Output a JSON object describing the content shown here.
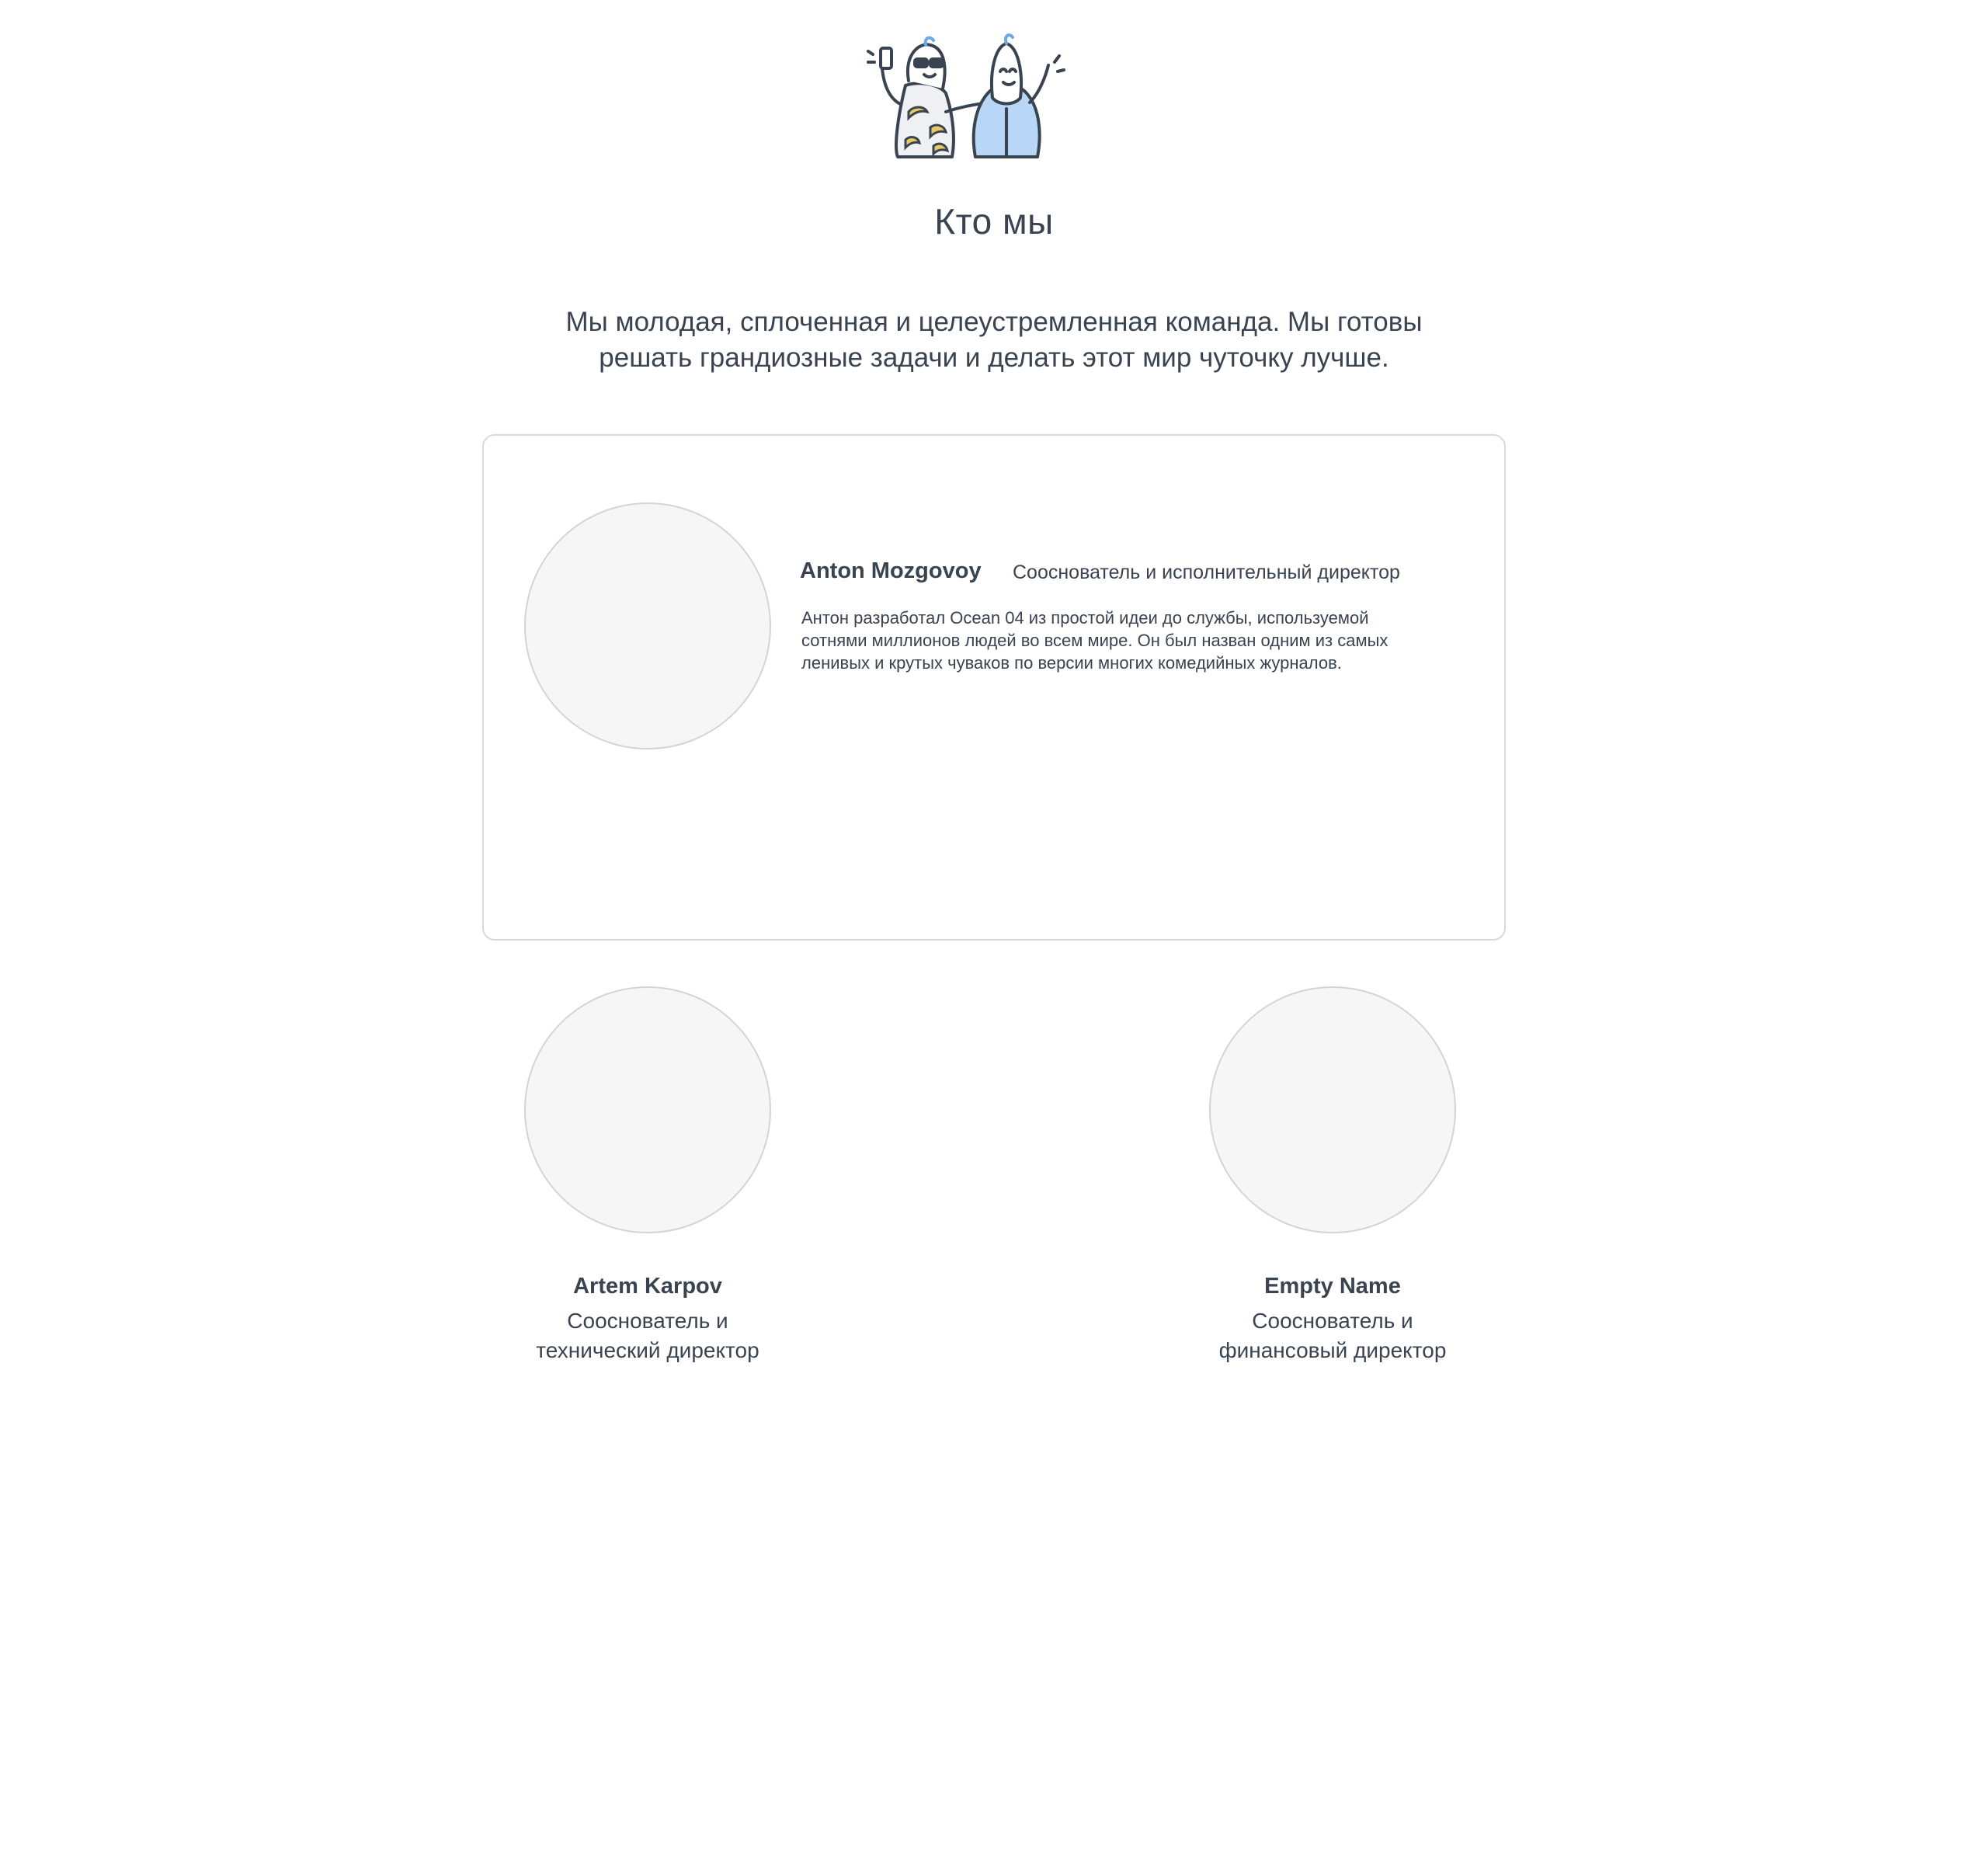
{
  "colors": {
    "text": "#3a4350",
    "card_border": "#d7d9dd",
    "avatar_fill": "#f6f6f6",
    "avatar_border": "#d4d4d4",
    "illustration_blue": "#b8d6f5",
    "illustration_accent": "#6ea8e6",
    "illustration_banana": "#e8c96a"
  },
  "hero": {
    "illustration": "team-mascots-illustration"
  },
  "about": {
    "title": "Кто мы",
    "intro": "Мы молодая, сплоченная и целеустремленная команда. Мы готовы решать грандиозные задачи и делать этот мир чуточку лучше."
  },
  "featured": {
    "name": "Anton Mozgovoy",
    "role": "Сооснователь и исполнительный директор",
    "bio": "Антон разработал Ocean 04 из простой идеи до службы, используемой сотнями миллионов людей во всем мире. Он был назван одним из самых ленивых и крутых чуваков по версии многих комедийных журналов."
  },
  "members": [
    {
      "name": "Artem Karpov",
      "role": "Сооснователь и\nтехнический директор"
    },
    {
      "name": "Empty Name",
      "role": "Сооснователь и\nфинансовый директор"
    }
  ]
}
